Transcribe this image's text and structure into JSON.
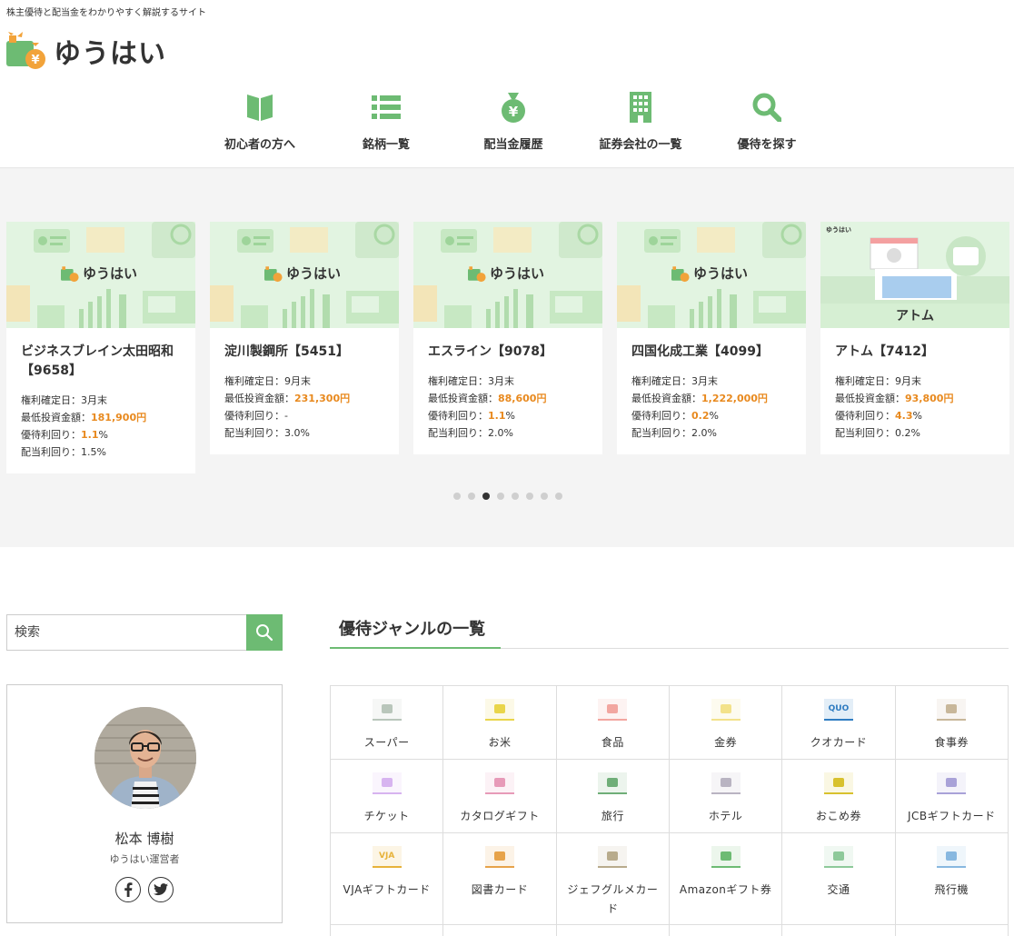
{
  "header": {
    "tagline": "株主優待と配当金をわかりやすく解説するサイト",
    "logo_text": "ゆうはい"
  },
  "nav": [
    {
      "label": "初心者の方へ",
      "icon": "book-icon"
    },
    {
      "label": "銘柄一覧",
      "icon": "list-icon"
    },
    {
      "label": "配当金履歴",
      "icon": "money-bag-icon"
    },
    {
      "label": "証券会社の一覧",
      "icon": "building-icon"
    },
    {
      "label": "優待を探す",
      "icon": "search-icon"
    }
  ],
  "cards": [
    {
      "thumb_text": "ゆうはい",
      "title": "ビジネスブレイン太田昭和【9658】",
      "record_label": "権利確定日：",
      "record": "3月末",
      "min_label": "最低投資金額：",
      "min": "181,900円",
      "yutai_label": "優待利回り：",
      "yutai": "1.1",
      "yutai_unit": "%",
      "div_label": "配当利回り：",
      "div": "1.5%"
    },
    {
      "thumb_text": "ゆうはい",
      "title": "淀川製鋼所【5451】",
      "record_label": "権利確定日：",
      "record": "9月末",
      "min_label": "最低投資金額：",
      "min": "231,300円",
      "yutai_label": "優待利回り：",
      "yutai": "-",
      "yutai_unit": "",
      "div_label": "配当利回り：",
      "div": "3.0%"
    },
    {
      "thumb_text": "ゆうはい",
      "title": "エスライン【9078】",
      "record_label": "権利確定日：",
      "record": "3月末",
      "min_label": "最低投資金額：",
      "min": "88,600円",
      "yutai_label": "優待利回り：",
      "yutai": "1.1",
      "yutai_unit": "%",
      "div_label": "配当利回り：",
      "div": "2.0%"
    },
    {
      "thumb_text": "ゆうはい",
      "title": "四国化成工業【4099】",
      "record_label": "権利確定日：",
      "record": "3月末",
      "min_label": "最低投資金額：",
      "min": "1,222,000円",
      "yutai_label": "優待利回り：",
      "yutai": "0.2",
      "yutai_unit": "%",
      "div_label": "配当利回り：",
      "div": "2.0%"
    },
    {
      "thumb_text": "アトム",
      "thumb_logo": "ゆうはい",
      "title": "アトム【7412】",
      "record_label": "権利確定日：",
      "record": "9月末",
      "min_label": "最低投資金額：",
      "min": "93,800円",
      "yutai_label": "優待利回り：",
      "yutai": "4.3",
      "yutai_unit": "%",
      "div_label": "配当利回り：",
      "div": "0.2%"
    }
  ],
  "slider": {
    "dot_count": 8,
    "active_index": 2
  },
  "sidebar": {
    "search_placeholder": "検索",
    "profile_name": "松本 博樹",
    "profile_role": "ゆうはい運営者"
  },
  "genre": {
    "title": "優待ジャンルの一覧",
    "items": [
      {
        "label": "スーパー",
        "icon": "basket-icon",
        "color": "#b9c6bb"
      },
      {
        "label": "お米",
        "icon": "rice-icon",
        "color": "#e9d54a"
      },
      {
        "label": "食品",
        "icon": "food-icon",
        "color": "#f2a6a0"
      },
      {
        "label": "金券",
        "icon": "voucher-icon",
        "color": "#f3e28a"
      },
      {
        "label": "クオカード",
        "icon": "quo-card-icon",
        "color": "#2f7cc1",
        "icon_text": "QUO"
      },
      {
        "label": "食事券",
        "icon": "meal-ticket-icon",
        "color": "#c8b79a"
      },
      {
        "label": "チケット",
        "icon": "ticket-icon",
        "color": "#d7b4f0"
      },
      {
        "label": "カタログギフト",
        "icon": "catalog-icon",
        "color": "#e79ab8"
      },
      {
        "label": "旅行",
        "icon": "travel-bag-icon",
        "color": "#6fae78"
      },
      {
        "label": "ホテル",
        "icon": "hotel-icon",
        "color": "#b9b4c2"
      },
      {
        "label": "おこめ券",
        "icon": "rice-ticket-icon",
        "color": "#d8c12e"
      },
      {
        "label": "JCBギフトカード",
        "icon": "gift-card-icon",
        "color": "#a9a2d8"
      },
      {
        "label": "VJAギフトカード",
        "icon": "vja-card-icon",
        "color": "#e7b23a",
        "icon_text": "VJA"
      },
      {
        "label": "図書カード",
        "icon": "book-card-icon",
        "color": "#e7a34a"
      },
      {
        "label": "ジェフグルメカード",
        "icon": "gourmet-card-icon",
        "color": "#b8ab8c"
      },
      {
        "label": "Amazonギフト券",
        "icon": "amazon-card-icon",
        "color": "#6dbb73"
      },
      {
        "label": "交通",
        "icon": "car-icon",
        "color": "#8ec99a"
      },
      {
        "label": "飛行機",
        "icon": "airplane-icon",
        "color": "#88b8e0"
      }
    ]
  },
  "colors": {
    "accent": "#6dbb73",
    "highlight": "#e8891e",
    "slider_bg": "#f4f4f4",
    "thumb_bg": "#e2f4e1"
  }
}
